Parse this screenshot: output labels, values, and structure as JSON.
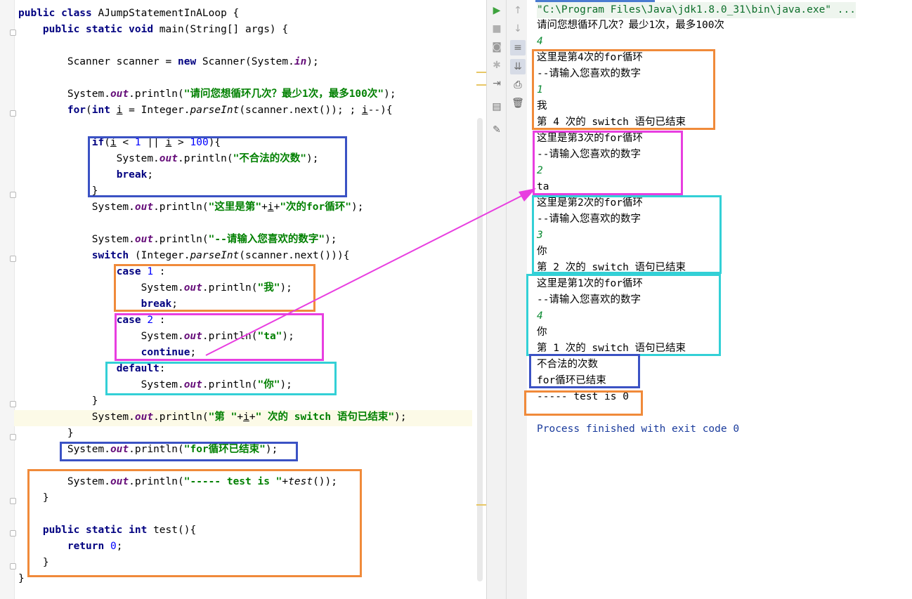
{
  "editor": {
    "lines": [
      [
        [
          "public class ",
          "kw"
        ],
        [
          "AJumpStatementInALoop {",
          ""
        ]
      ],
      [
        [
          "    ",
          ""
        ],
        [
          "public static void ",
          "kw"
        ],
        [
          "main(String[] args) {",
          ""
        ]
      ],
      [
        [
          "",
          ""
        ]
      ],
      [
        [
          "        Scanner scanner = ",
          ""
        ],
        [
          "new ",
          "kw"
        ],
        [
          "Scanner(System.",
          ""
        ],
        [
          "in",
          "fld"
        ],
        [
          ");",
          ""
        ]
      ],
      [
        [
          "",
          ""
        ]
      ],
      [
        [
          "        System.",
          ""
        ],
        [
          "out",
          "fld"
        ],
        [
          ".println(",
          ""
        ],
        [
          "\"请问您想循环几次？最少1次，最多100次\"",
          "str"
        ],
        [
          ");",
          ""
        ]
      ],
      [
        [
          "        ",
          ""
        ],
        [
          "for",
          "kw"
        ],
        [
          "(",
          ""
        ],
        [
          "int ",
          "kw"
        ],
        [
          "i",
          "ul"
        ],
        [
          " = Integer.",
          ""
        ],
        [
          "parseInt",
          "it"
        ],
        [
          "(scanner.next()); ; ",
          ""
        ],
        [
          "i",
          "ul"
        ],
        [
          "--){",
          ""
        ]
      ],
      [
        [
          "",
          ""
        ]
      ],
      [
        [
          "            ",
          ""
        ],
        [
          "if",
          "kw"
        ],
        [
          "(",
          ""
        ],
        [
          "i",
          "ul"
        ],
        [
          " < ",
          ""
        ],
        [
          "1",
          "num"
        ],
        [
          " || ",
          ""
        ],
        [
          "i",
          "ul"
        ],
        [
          " > ",
          ""
        ],
        [
          "100",
          "num"
        ],
        [
          "){",
          ""
        ]
      ],
      [
        [
          "                System.",
          ""
        ],
        [
          "out",
          "fld"
        ],
        [
          ".println(",
          ""
        ],
        [
          "\"不合法的次数\"",
          "str"
        ],
        [
          ");",
          ""
        ]
      ],
      [
        [
          "                ",
          ""
        ],
        [
          "break",
          "kw"
        ],
        [
          ";",
          ""
        ]
      ],
      [
        [
          "            }",
          ""
        ]
      ],
      [
        [
          "            System.",
          ""
        ],
        [
          "out",
          "fld"
        ],
        [
          ".println(",
          ""
        ],
        [
          "\"这里是第\"",
          "str"
        ],
        [
          "+",
          ""
        ],
        [
          "i",
          "ul"
        ],
        [
          "+",
          ""
        ],
        [
          "\"次的for循环\"",
          "str"
        ],
        [
          ");",
          ""
        ]
      ],
      [
        [
          "",
          ""
        ]
      ],
      [
        [
          "            System.",
          ""
        ],
        [
          "out",
          "fld"
        ],
        [
          ".println(",
          ""
        ],
        [
          "\"--请输入您喜欢的数字\"",
          "str"
        ],
        [
          ");",
          ""
        ]
      ],
      [
        [
          "            ",
          ""
        ],
        [
          "switch ",
          "kw"
        ],
        [
          "(Integer.",
          ""
        ],
        [
          "parseInt",
          "it"
        ],
        [
          "(scanner.next())){",
          ""
        ]
      ],
      [
        [
          "                ",
          ""
        ],
        [
          "case ",
          "kw"
        ],
        [
          "1",
          "num"
        ],
        [
          " :",
          ""
        ]
      ],
      [
        [
          "                    System.",
          ""
        ],
        [
          "out",
          "fld"
        ],
        [
          ".println(",
          ""
        ],
        [
          "\"我\"",
          "str"
        ],
        [
          ");",
          ""
        ]
      ],
      [
        [
          "                    ",
          ""
        ],
        [
          "break",
          "kw"
        ],
        [
          ";",
          ""
        ]
      ],
      [
        [
          "                ",
          ""
        ],
        [
          "case ",
          "kw"
        ],
        [
          "2",
          "num"
        ],
        [
          " :",
          ""
        ]
      ],
      [
        [
          "                    System.",
          ""
        ],
        [
          "out",
          "fld"
        ],
        [
          ".println(",
          ""
        ],
        [
          "\"ta\"",
          "str"
        ],
        [
          ");",
          ""
        ]
      ],
      [
        [
          "                    ",
          ""
        ],
        [
          "continue",
          "kw"
        ],
        [
          ";",
          ""
        ]
      ],
      [
        [
          "                ",
          ""
        ],
        [
          "default",
          "kw"
        ],
        [
          ":",
          ""
        ]
      ],
      [
        [
          "                    System.",
          ""
        ],
        [
          "out",
          "fld"
        ],
        [
          ".println(",
          ""
        ],
        [
          "\"你\"",
          "str"
        ],
        [
          ");",
          ""
        ]
      ],
      [
        [
          "            }",
          ""
        ]
      ],
      [
        [
          "            System.",
          ""
        ],
        [
          "out",
          "fld"
        ],
        [
          ".println(",
          ""
        ],
        [
          "\"第 \"",
          "str"
        ],
        [
          "+",
          ""
        ],
        [
          "i",
          "ul"
        ],
        [
          "+",
          ""
        ],
        [
          "\" 次的 switch 语句已结束\"",
          "str"
        ],
        [
          ");",
          ""
        ]
      ],
      [
        [
          "        }",
          ""
        ]
      ],
      [
        [
          "        System.",
          ""
        ],
        [
          "out",
          "fld"
        ],
        [
          ".println(",
          ""
        ],
        [
          "\"for循环已结束\"",
          "str"
        ],
        [
          ");",
          ""
        ]
      ],
      [
        [
          "",
          ""
        ]
      ],
      [
        [
          "        System.",
          ""
        ],
        [
          "out",
          "fld"
        ],
        [
          ".println(",
          ""
        ],
        [
          "\"----- test is \"",
          "str"
        ],
        [
          "+",
          ""
        ],
        [
          "test",
          "it"
        ],
        [
          "());",
          ""
        ]
      ],
      [
        [
          "    }",
          ""
        ]
      ],
      [
        [
          "",
          ""
        ]
      ],
      [
        [
          "    ",
          ""
        ],
        [
          "public ",
          "kw"
        ],
        [
          "static int ",
          "kw"
        ],
        [
          "test(){",
          ""
        ]
      ],
      [
        [
          "        ",
          ""
        ],
        [
          "return ",
          "kw"
        ],
        [
          "0",
          "num"
        ],
        [
          ";",
          ""
        ]
      ],
      [
        [
          "    }",
          ""
        ]
      ],
      [
        [
          "}",
          ""
        ]
      ]
    ]
  },
  "console": {
    "lines": [
      [
        "\"C:\\Program Files\\Java\\jdk1.8.0_31\\bin\\java.exe\" ...",
        "cmd"
      ],
      [
        "请问您想循环几次？最少1次，最多100次",
        ""
      ],
      [
        "4",
        "inp"
      ],
      [
        "这里是第4次的for循环",
        ""
      ],
      [
        "--请输入您喜欢的数字",
        ""
      ],
      [
        "1",
        "inp"
      ],
      [
        "我",
        ""
      ],
      [
        "第 4 次的 switch 语句已结束",
        ""
      ],
      [
        "这里是第3次的for循环",
        ""
      ],
      [
        "--请输入您喜欢的数字",
        ""
      ],
      [
        "2",
        "inp"
      ],
      [
        "ta",
        ""
      ],
      [
        "这里是第2次的for循环",
        ""
      ],
      [
        "--请输入您喜欢的数字",
        ""
      ],
      [
        "3",
        "inp"
      ],
      [
        "你",
        ""
      ],
      [
        "第 2 次的 switch 语句已结束",
        ""
      ],
      [
        "这里是第1次的for循环",
        ""
      ],
      [
        "--请输入您喜欢的数字",
        ""
      ],
      [
        "4",
        "inp"
      ],
      [
        "你",
        ""
      ],
      [
        "第 1 次的 switch 语句已结束",
        ""
      ],
      [
        "不合法的次数",
        ""
      ],
      [
        "for循环已结束",
        ""
      ],
      [
        "----- test is 0",
        ""
      ],
      [
        "",
        ""
      ],
      [
        "Process finished with exit code 0",
        "fin"
      ]
    ]
  },
  "toolbar": {
    "icons": [
      "run-icon",
      "stop-icon",
      "camera-icon",
      "debug-bug-icon",
      "exit-icon",
      "layout-icon",
      "pin-icon",
      "scroll-up-icon",
      "scroll-down-icon",
      "soft-wrap-icon",
      "scroll-to-end-icon",
      "print-icon",
      "trash-icon"
    ]
  },
  "colors": {
    "keyword": "#000080",
    "string": "#008000",
    "number": "#0000ff",
    "field": "#660e7a",
    "annotation_blue": "#3b52c4",
    "annotation_orange": "#f08a3a",
    "annotation_magenta": "#e83ee0",
    "annotation_cyan": "#33d0d6"
  }
}
